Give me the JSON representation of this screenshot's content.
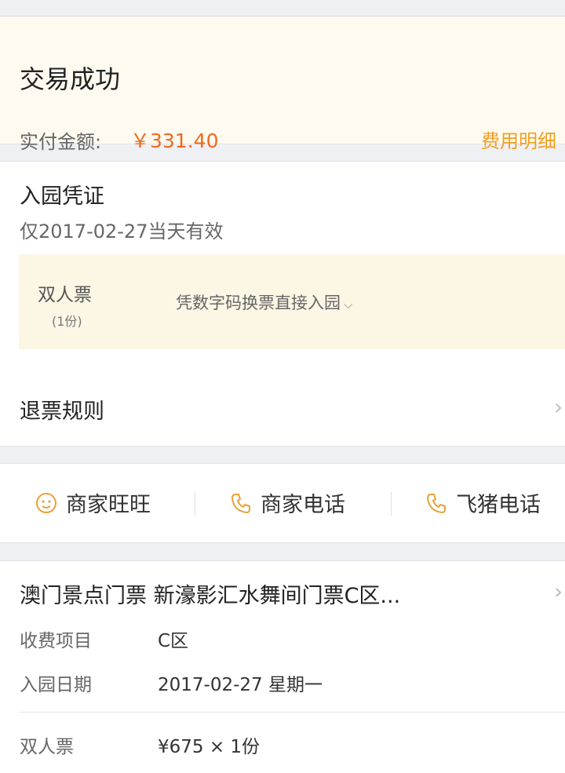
{
  "order_status": {
    "title": "交易成功",
    "amount_label": "实付金额:",
    "amount_value": "￥331.40",
    "fee_detail_link": "费用明细"
  },
  "voucher": {
    "title": "入园凭证",
    "validity": "仅2017-02-27当天有效",
    "ticket": {
      "name": "双人票",
      "quantity": "(1份)",
      "method": "凭数字码换票直接入园"
    },
    "refund_rules_label": "退票规则"
  },
  "contacts": [
    {
      "label": "商家旺旺",
      "icon": "chat-face-icon"
    },
    {
      "label": "商家电话",
      "icon": "phone-icon"
    },
    {
      "label": "飞猪电话",
      "icon": "phone-icon"
    }
  ],
  "product": {
    "title": "澳门景点门票 新濠影汇水舞间门票C区...",
    "rows": [
      {
        "label": "收费项目",
        "value": "C区"
      },
      {
        "label": "入园日期",
        "value": "2017-02-27 星期一"
      }
    ],
    "price_row": {
      "label": "双人票",
      "value": "¥675 × 1份"
    }
  },
  "colors": {
    "accent_orange": "#ee6a1c",
    "link_gold": "#f0a01e",
    "icon_gold": "#e9a23b",
    "status_bg": "#fffaf0",
    "ticket_bg": "#fcf6e5"
  }
}
